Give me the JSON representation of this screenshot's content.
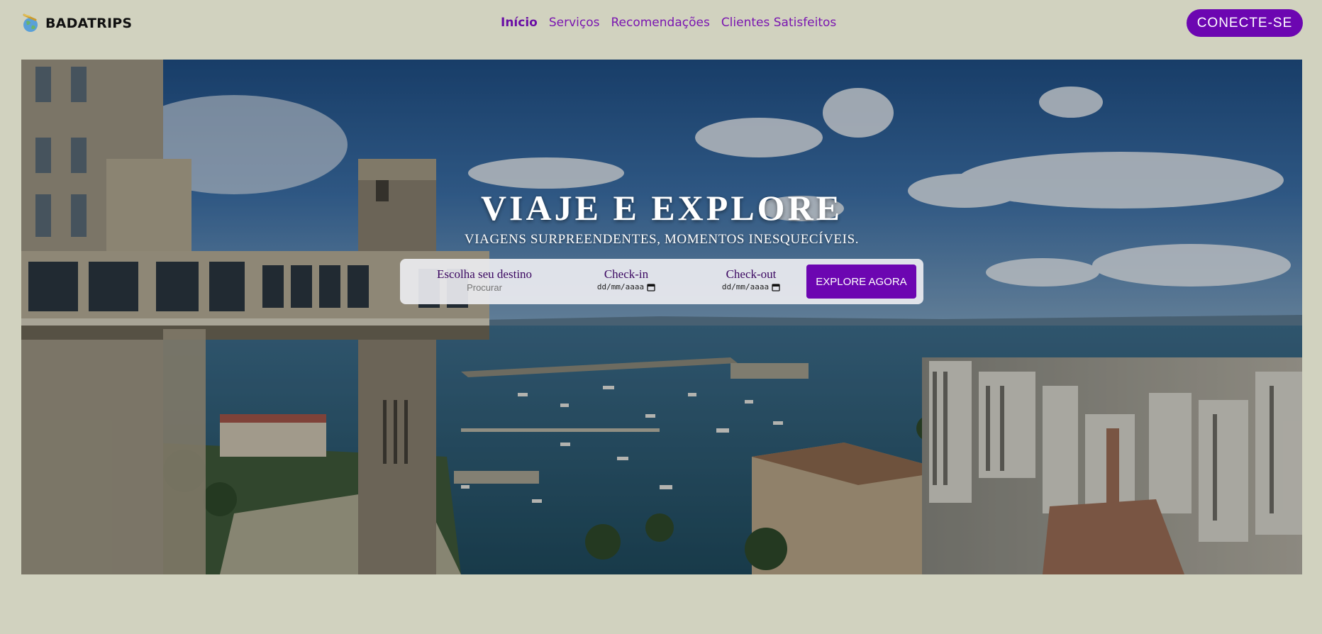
{
  "brand": {
    "name": "BADATRIPS",
    "icon": "globe-icon"
  },
  "nav": {
    "items": [
      {
        "label": "Início",
        "active": true
      },
      {
        "label": "Serviços",
        "active": false
      },
      {
        "label": "Recomendações",
        "active": false
      },
      {
        "label": "Clientes Satisfeitos",
        "active": false
      }
    ],
    "connect_label": "CONECTE-SE"
  },
  "hero": {
    "title": "VIAJE E EXPLORE",
    "subtitle": "VIAGENS SURPREENDENTES, MOMENTOS INESQUECÍVEIS.",
    "search": {
      "destination_label": "Escolha seu destino",
      "destination_placeholder": "Procurar",
      "checkin_label": "Check-in",
      "checkin_value": "dd/mm/aaaa",
      "checkout_label": "Check-out",
      "checkout_value": "dd/mm/aaaa",
      "button_label": "EXPLORE AGORA"
    }
  },
  "colors": {
    "background": "#d1d2bf",
    "accent": "#6c06b1",
    "nav_link": "#7a16b0"
  }
}
